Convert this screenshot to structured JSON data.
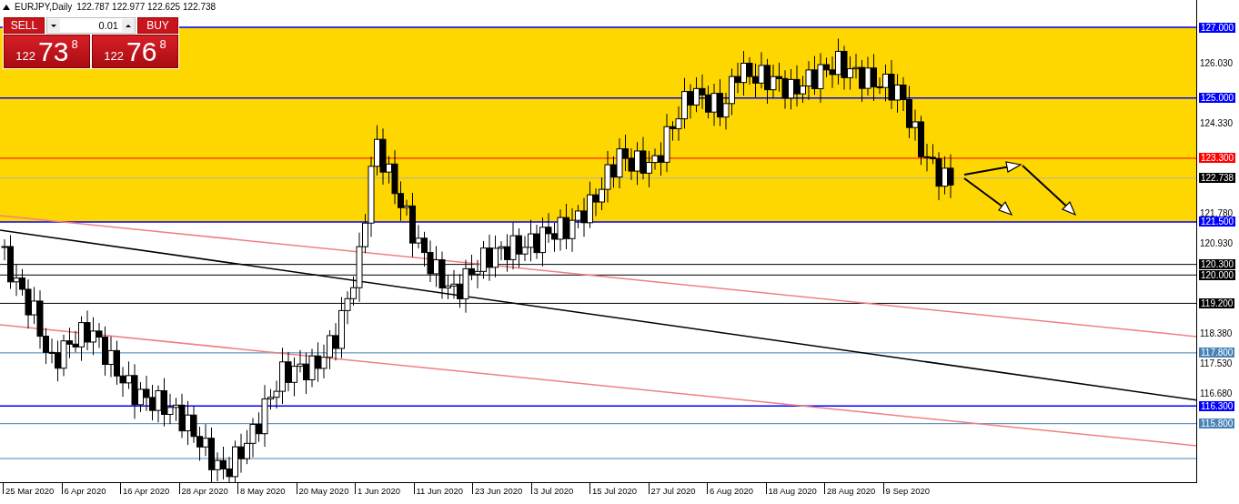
{
  "header": {
    "symbol": "EURJPY,Daily",
    "ohlc": "122.787 122.977 122.625 122.738"
  },
  "trade_panel": {
    "sell_label": "SELL",
    "buy_label": "BUY",
    "lot": "0.01",
    "sell_price": {
      "prefix": "122",
      "big": "73",
      "pip": "8"
    },
    "buy_price": {
      "prefix": "122",
      "big": "76",
      "pip": "8"
    }
  },
  "price_axis": {
    "ticks": [
      "126.030",
      "124.330",
      "121.780",
      "120.930",
      "118.380",
      "117.530",
      "116.680"
    ]
  },
  "levels": [
    {
      "label": "127.000",
      "kind": "level",
      "color": "#0000ff"
    },
    {
      "label": "125.000",
      "kind": "level",
      "color": "#0000ff"
    },
    {
      "label": "123.300",
      "kind": "level",
      "color": "#ff0000"
    },
    {
      "label": "122.738",
      "kind": "bid",
      "color": "#000000"
    },
    {
      "label": "121.500",
      "kind": "level",
      "color": "#0000ff"
    },
    {
      "label": "120.300",
      "kind": "level",
      "color": "#000000"
    },
    {
      "label": "120.000",
      "kind": "level",
      "color": "#000000"
    },
    {
      "label": "119.200",
      "kind": "level",
      "color": "#000000"
    },
    {
      "label": "117.800",
      "kind": "level",
      "color": "#4682b4"
    },
    {
      "label": "116.300",
      "kind": "level",
      "color": "#0000ff"
    },
    {
      "label": "115.800",
      "kind": "level",
      "color": "#4682b4"
    }
  ],
  "date_axis": {
    "labels": [
      "25 Mar 2020",
      "6 Apr 2020",
      "16 Apr 2020",
      "28 Apr 2020",
      "8 May 2020",
      "20 May 2020",
      "1 Jun 2020",
      "11 Jun 2020",
      "23 Jun 2020",
      "3 Jul 2020",
      "15 Jul 2020",
      "27 Jul 2020",
      "6 Aug 2020",
      "18 Aug 2020",
      "28 Aug 2020",
      "9 Sep 2020"
    ]
  }
}
